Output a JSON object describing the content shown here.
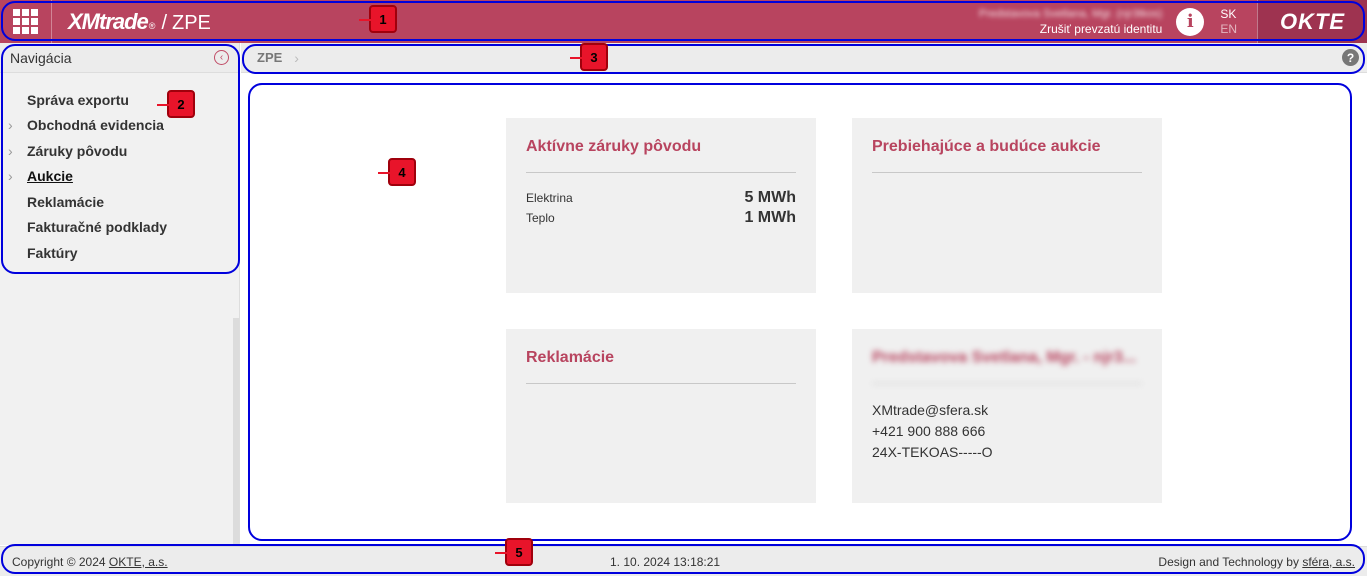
{
  "topbar": {
    "brand_main": "XMtrade",
    "brand_reg": "®",
    "brand_sep": "/",
    "brand_module": "ZPE",
    "user_name_blurred": "Predstavova Svetlana, Mgr. (njr3tkos)",
    "identity_link": "Zrušiť prevzatú identitu",
    "info_icon": "info-icon",
    "lang_active": "SK",
    "lang_inactive": "EN",
    "okte_logo": "OKTE"
  },
  "sidebar": {
    "title": "Navigácia",
    "items": [
      {
        "label": "Správa exportu",
        "expandable": false,
        "active": false
      },
      {
        "label": "Obchodná evidencia",
        "expandable": true,
        "active": false
      },
      {
        "label": "Záruky pôvodu",
        "expandable": true,
        "active": false
      },
      {
        "label": "Aukcie",
        "expandable": true,
        "active": true
      },
      {
        "label": "Reklamácie",
        "expandable": false,
        "active": false
      },
      {
        "label": "Fakturačné podklady",
        "expandable": false,
        "active": false
      },
      {
        "label": "Faktúry",
        "expandable": false,
        "active": false
      }
    ]
  },
  "breadcrumb": {
    "items": [
      "ZPE"
    ]
  },
  "cards": {
    "active_guarantees": {
      "title": "Aktívne záruky pôvodu",
      "rows": [
        {
          "label": "Elektrina",
          "value": "5 MWh"
        },
        {
          "label": "Teplo",
          "value": "1 MWh"
        }
      ]
    },
    "auctions": {
      "title": "Prebiehajúce a budúce aukcie"
    },
    "complaints": {
      "title": "Reklamácie"
    },
    "account": {
      "title_blurred": "Predstavova Svetlana, Mgr. - njr3...",
      "email": "XMtrade@sfera.sk",
      "phone": "+421 900 888 666",
      "code": "24X-TEKOAS-----O"
    }
  },
  "footer": {
    "copyright_prefix": "Copyright © 2024",
    "copyright_link": "OKTE, a.s.",
    "datetime": "1. 10. 2024 13:18:21",
    "design_prefix": "Design and Technology by",
    "design_link": "sféra, a.s."
  },
  "annotations": [
    "1",
    "2",
    "3",
    "4",
    "5"
  ],
  "colors": {
    "accent": "#b8445f",
    "annotation_outline": "#0000dd",
    "annotation_badge": "#e8142a"
  }
}
